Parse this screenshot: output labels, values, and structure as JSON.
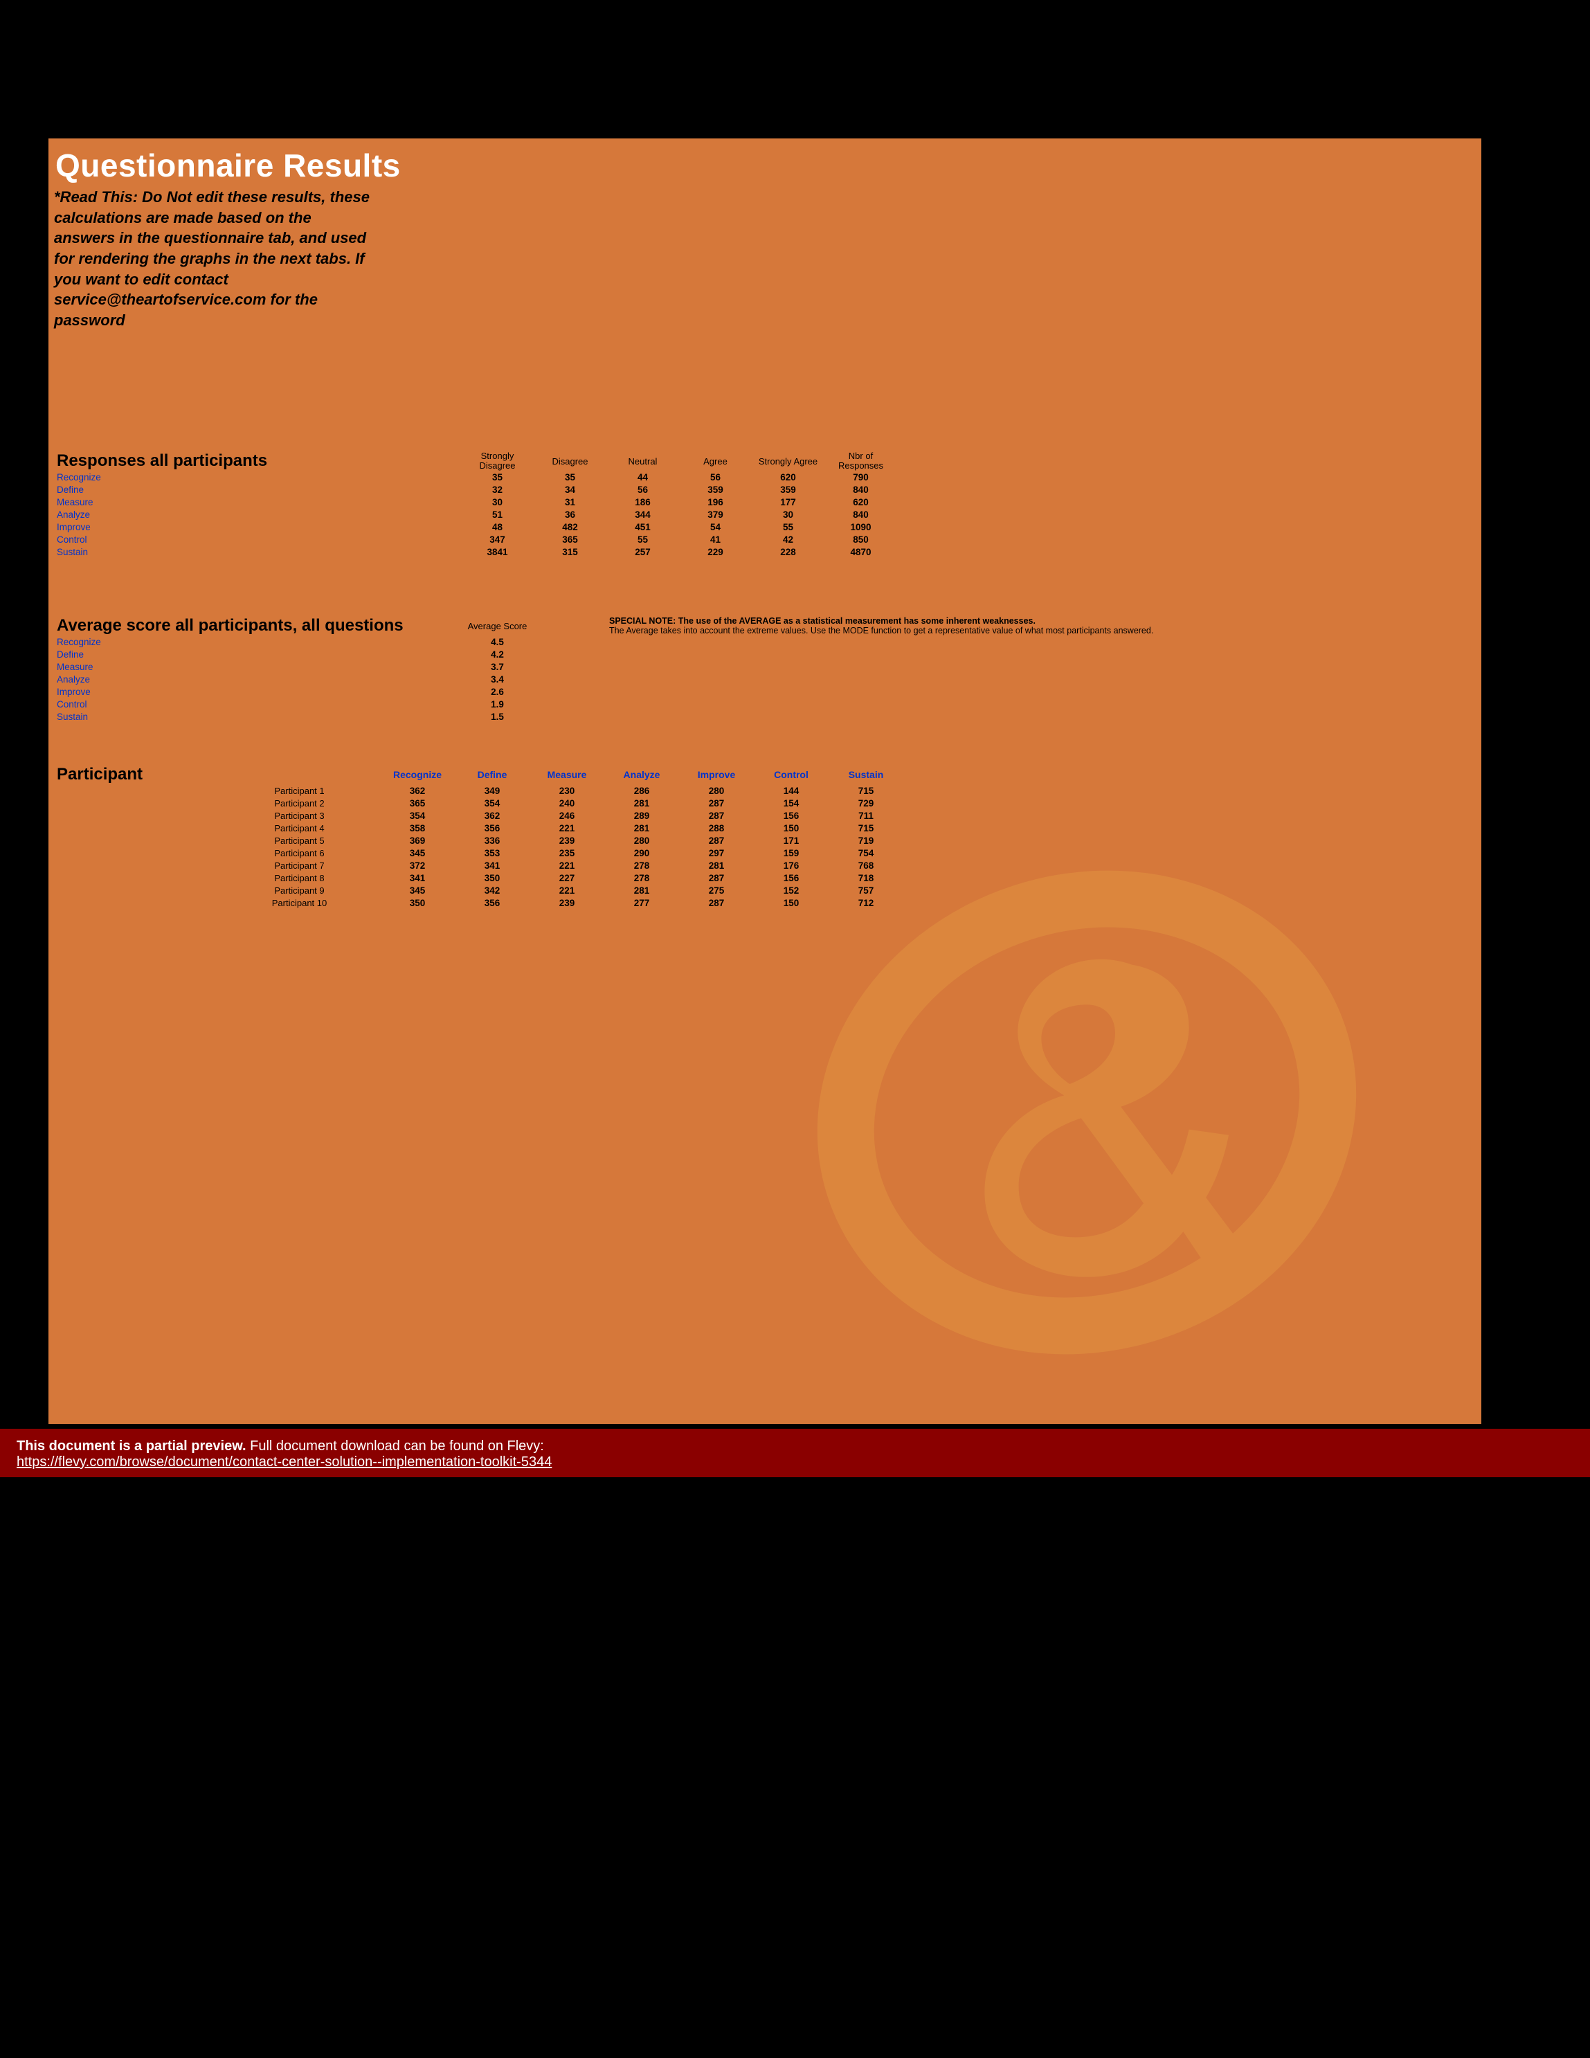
{
  "title": "Questionnaire Results",
  "warning": "*Read This: Do Not edit these results, these calculations are made based on the answers in the questionnaire tab, and used for rendering the graphs in the next tabs. If you want to edit contact service@theartofservice.com for the password",
  "responses": {
    "heading": "Responses all participants",
    "cols": [
      "Strongly Disagree",
      "Disagree",
      "Neutral",
      "Agree",
      "Strongly Agree",
      "Nbr of Responses"
    ],
    "rows": [
      {
        "label": "Recognize",
        "v": [
          "35",
          "35",
          "44",
          "56",
          "620",
          "790"
        ]
      },
      {
        "label": "Define",
        "v": [
          "32",
          "34",
          "56",
          "359",
          "359",
          "840"
        ]
      },
      {
        "label": "Measure",
        "v": [
          "30",
          "31",
          "186",
          "196",
          "177",
          "620"
        ]
      },
      {
        "label": "Analyze",
        "v": [
          "51",
          "36",
          "344",
          "379",
          "30",
          "840"
        ]
      },
      {
        "label": "Improve",
        "v": [
          "48",
          "482",
          "451",
          "54",
          "55",
          "1090"
        ]
      },
      {
        "label": "Control",
        "v": [
          "347",
          "365",
          "55",
          "41",
          "42",
          "850"
        ]
      },
      {
        "label": "Sustain",
        "v": [
          "3841",
          "315",
          "257",
          "229",
          "228",
          "4870"
        ]
      }
    ]
  },
  "averages": {
    "heading": "Average score all participants, all questions",
    "colh": "Average Score",
    "rows": [
      {
        "label": "Recognize",
        "v": "4.5"
      },
      {
        "label": "Define",
        "v": "4.2"
      },
      {
        "label": "Measure",
        "v": "3.7"
      },
      {
        "label": "Analyze",
        "v": "3.4"
      },
      {
        "label": "Improve",
        "v": "2.6"
      },
      {
        "label": "Control",
        "v": "1.9"
      },
      {
        "label": "Sustain",
        "v": "1.5"
      }
    ],
    "note_bold": "SPECIAL NOTE: The use of the AVERAGE as a statistical measurement has some inherent weaknesses.",
    "note_rest": "The Average takes into account the extreme values. Use the MODE function to get a representative value of what most participants answered."
  },
  "participants": {
    "heading": "Participant",
    "cols": [
      "Recognize",
      "Define",
      "Measure",
      "Analyze",
      "Improve",
      "Control",
      "Sustain"
    ],
    "rows": [
      {
        "name": "Participant 1",
        "v": [
          "362",
          "349",
          "230",
          "286",
          "280",
          "144",
          "715"
        ]
      },
      {
        "name": "Participant 2",
        "v": [
          "365",
          "354",
          "240",
          "281",
          "287",
          "154",
          "729"
        ]
      },
      {
        "name": "Participant 3",
        "v": [
          "354",
          "362",
          "246",
          "289",
          "287",
          "156",
          "711"
        ]
      },
      {
        "name": "Participant 4",
        "v": [
          "358",
          "356",
          "221",
          "281",
          "288",
          "150",
          "715"
        ]
      },
      {
        "name": "Participant 5",
        "v": [
          "369",
          "336",
          "239",
          "280",
          "287",
          "171",
          "719"
        ]
      },
      {
        "name": "Participant 6",
        "v": [
          "345",
          "353",
          "235",
          "290",
          "297",
          "159",
          "754"
        ]
      },
      {
        "name": "Participant 7",
        "v": [
          "372",
          "341",
          "221",
          "278",
          "281",
          "176",
          "768"
        ]
      },
      {
        "name": "Participant 8",
        "v": [
          "341",
          "350",
          "227",
          "278",
          "287",
          "156",
          "718"
        ]
      },
      {
        "name": "Participant 9",
        "v": [
          "345",
          "342",
          "221",
          "281",
          "275",
          "152",
          "757"
        ]
      },
      {
        "name": "Participant 10",
        "v": [
          "350",
          "356",
          "239",
          "277",
          "287",
          "150",
          "712"
        ]
      }
    ]
  },
  "footer": {
    "bold": "This document is a partial preview.",
    "rest": "  Full document download can be found on Flevy:",
    "link": "https://flevy.com/browse/document/contact-center-solution--implementation-toolkit-5344"
  }
}
